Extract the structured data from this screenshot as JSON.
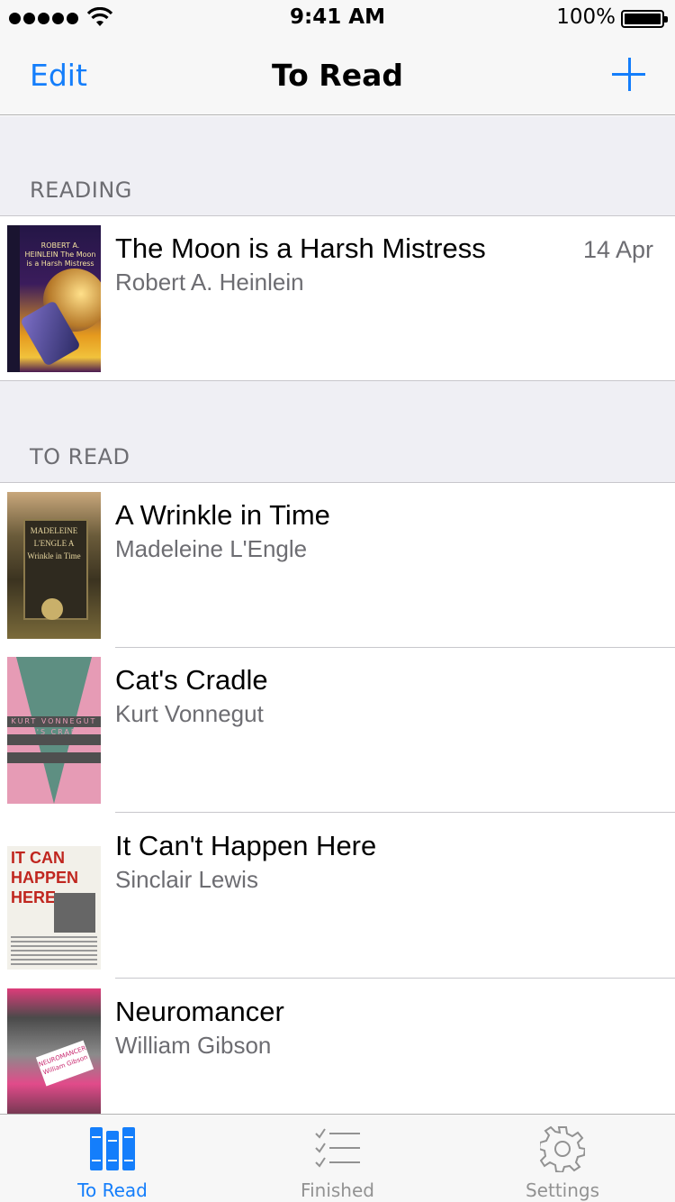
{
  "status_bar": {
    "time": "9:41 AM",
    "battery_percent": "100%",
    "battery_level": 1.0
  },
  "nav_bar": {
    "left_button": "Edit",
    "title": "To Read",
    "right_icon": "plus-icon"
  },
  "sections": [
    {
      "header": "READING",
      "books": [
        {
          "title": "The Moon is a Harsh Mistress",
          "author": "Robert A. Heinlein",
          "date": "14 Apr",
          "cover_text": "ROBERT A. HEINLEIN The Moon is a Harsh Mistress"
        }
      ]
    },
    {
      "header": "TO READ",
      "books": [
        {
          "title": "A Wrinkle in Time",
          "author": "Madeleine L'Engle",
          "cover_text": "MADELEINE L'ENGLE A Wrinkle in Time"
        },
        {
          "title": "Cat's Cradle",
          "author": "Kurt Vonnegut",
          "cover_text": "KURT VONNEGUT CAT'S CRADLE"
        },
        {
          "title": "It Can't Happen Here",
          "author": "Sinclair Lewis",
          "cover_text": "IT CAN HAPPEN HERE"
        },
        {
          "title": "Neuromancer",
          "author": "William Gibson",
          "cover_text": "NEUROMANCER William Gibson"
        }
      ]
    }
  ],
  "tab_bar": {
    "tabs": [
      {
        "label": "To Read",
        "icon": "books-icon",
        "active": true
      },
      {
        "label": "Finished",
        "icon": "checklist-icon",
        "active": false
      },
      {
        "label": "Settings",
        "icon": "gear-icon",
        "active": false
      }
    ]
  },
  "colors": {
    "accent": "#147efb",
    "secondary_text": "#6d6d72",
    "section_background": "#efeff4",
    "inactive_tab": "#929292"
  }
}
